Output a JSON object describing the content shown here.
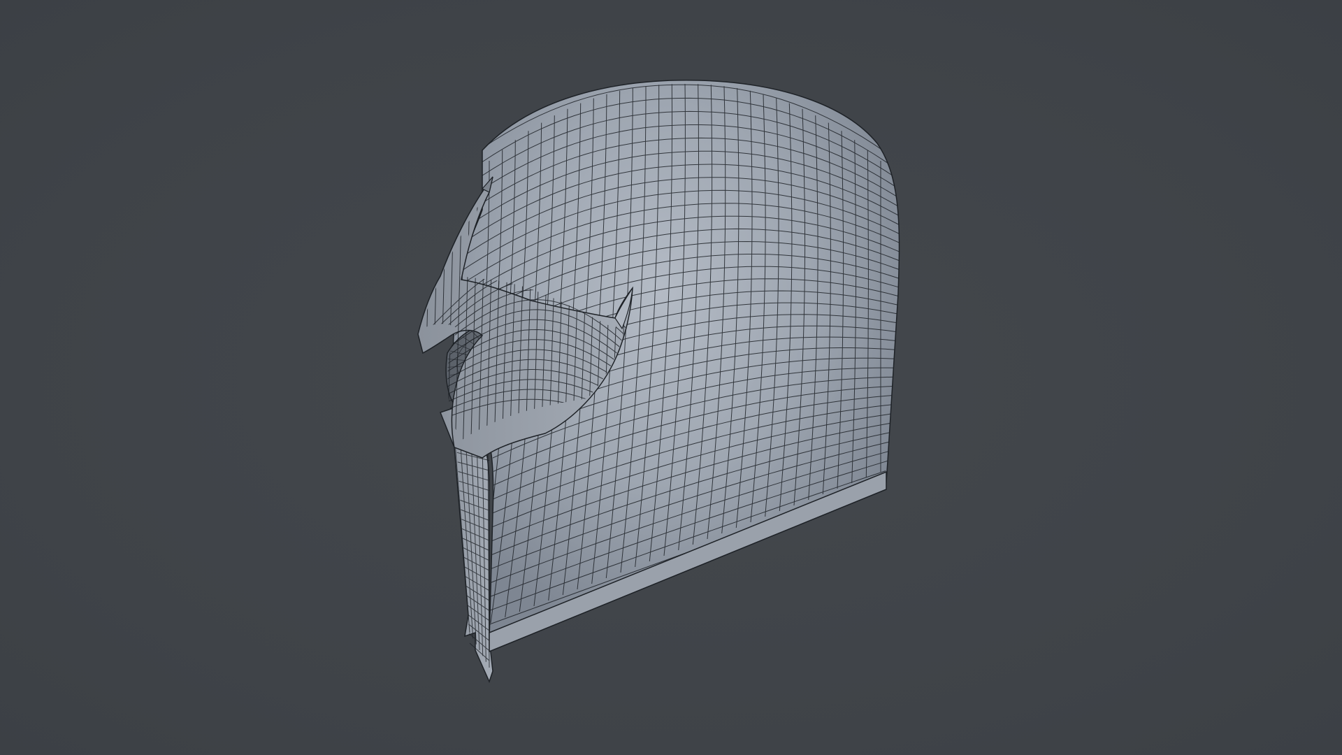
{
  "scene": {
    "subject": "",
    "background_color": "#41454a",
    "surface_color": "#a3aab4",
    "wire_color": "#1e2227",
    "interior_color": "#6a717a"
  }
}
